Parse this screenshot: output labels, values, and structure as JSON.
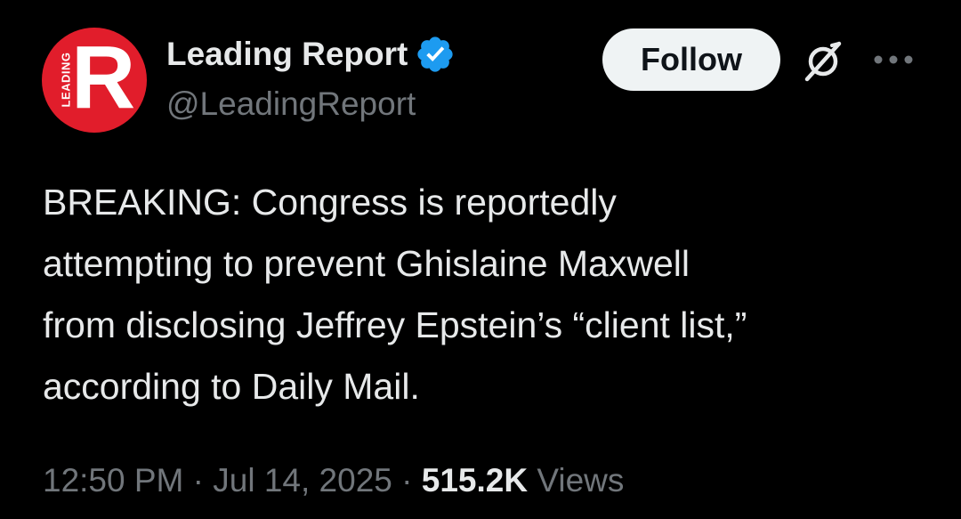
{
  "author": {
    "avatar": {
      "letter": "R",
      "side_text": "LEADING",
      "background_color": "#e11d2b"
    },
    "display_name": "Leading Report",
    "verified": true,
    "verified_color": "#1d9bf0",
    "handle": "@LeadingReport"
  },
  "actions": {
    "follow_label": "Follow",
    "grok_icon": "grok-icon",
    "more_icon": "more-horizontal-icon"
  },
  "tweet": {
    "lines": [
      "BREAKING: Congress is reportedly",
      "attempting to prevent Ghislaine Maxwell",
      "from disclosing Jeffrey Epstein’s “client list,”",
      "according to Daily Mail."
    ]
  },
  "meta": {
    "time": "12:50 PM",
    "separator": "·",
    "date": "Jul 14, 2025",
    "views_count": "515.2K",
    "views_label": "Views"
  },
  "colors": {
    "background": "#000000",
    "primary_text": "#e7e9ea",
    "secondary_text": "#71767b",
    "follow_button_bg": "#eff3f4"
  }
}
